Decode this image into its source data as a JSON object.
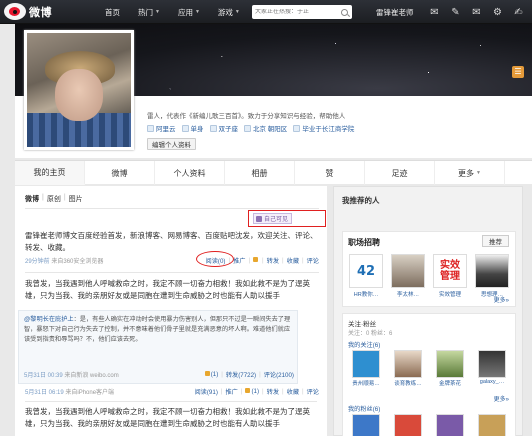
{
  "logo": {
    "text": "微博"
  },
  "nav": {
    "items": [
      {
        "label": "首页",
        "caret": false
      },
      {
        "label": "热门",
        "caret": true
      },
      {
        "label": "应用",
        "caret": true
      },
      {
        "label": "游戏",
        "caret": true
      }
    ],
    "search_placeholder": "大家正在热搜：于正",
    "user": "雷锋崔老师"
  },
  "profile": {
    "bio": "雷人，代表作《新编儿歌三百首》。致力于分享知识与经验，帮助他人",
    "tags": [
      "阿里云",
      "单身",
      "双子座",
      "北京 朝阳区",
      "毕业于长江商学院"
    ],
    "edit_button": "编辑个人资料"
  },
  "tabs": [
    "我的主页",
    "微博",
    "个人资料",
    "相册",
    "赞",
    "足迹",
    "更多"
  ],
  "filters": {
    "all": "微博",
    "original": "原创",
    "pictures": "图片"
  },
  "post1": {
    "privacy": "自己可见",
    "text": "雷锋崔老师博文百度经验首发，新浪博客、网易博客、百度贴吧沈发，欢迎关注、评论、转发、收藏。",
    "time": "29分钟前",
    "source": "来自360安全浏览器",
    "read": "阅读(0)",
    "promote": "推广",
    "forward": "转发",
    "favorite": "收藏",
    "comment": "评论"
  },
  "post2": {
    "text": "我曾发，当我遇到他人呼喊救命之时，我定不顾一切奋力相救！我如此救不是为了逞英雄，只为当我、我的亲朋好友或是同胞在遭到生命威胁之时也能有人助以援手",
    "quote_name": "@黎明长在庇护上",
    "quote_text": "：是，有些人确实在冲动时会使用暴力伤害别人，但那只不过是一瞬间失去了理智，暴怒下对自己行为失去了控制，并不意味着他们骨子里就是充满恶意的坏人啊。难道他们就应该受到指责和辱骂吗？不，他们应该去死。",
    "quote_time": "5月31日 00:39",
    "quote_source": "来自新浪 weibo.com",
    "quote_likes": "(1)",
    "quote_forward": "转发(7722)",
    "quote_comment": "评论(2100)",
    "time": "5月31日 06:19",
    "source": "来自iPhone客户端",
    "read": "阅读(91)",
    "promote": "推广",
    "likes": "(1)",
    "forward": "转发",
    "favorite": "收藏",
    "comment": "评论"
  },
  "post3": {
    "text": "我曾发，当我遇到他人呼喊救命之时，我定不顾一切奋力相救！我如此救不是为了逞英雄，只为当我、我的亲朋好友或是同胞在遭到生命威胁之时也能有人助以援手"
  },
  "sidebar": {
    "title": "我推荐的人",
    "jobs": {
      "title": "职场招聘",
      "button": "推荐",
      "cards": [
        "HR教你…",
        "李太林…",
        "实效管理",
        "思想理…"
      ],
      "more": "更多»"
    },
    "follow": {
      "head": "关注·粉丝",
      "sub": "关注：0 粉丝：6",
      "my_following": "我的关注(6)",
      "following": [
        "贵州顺易…",
        "谈育教练…",
        "金牌茶花",
        "galaxy_…"
      ],
      "more": "更多»",
      "my_fans": "我的粉丝(6)"
    }
  }
}
